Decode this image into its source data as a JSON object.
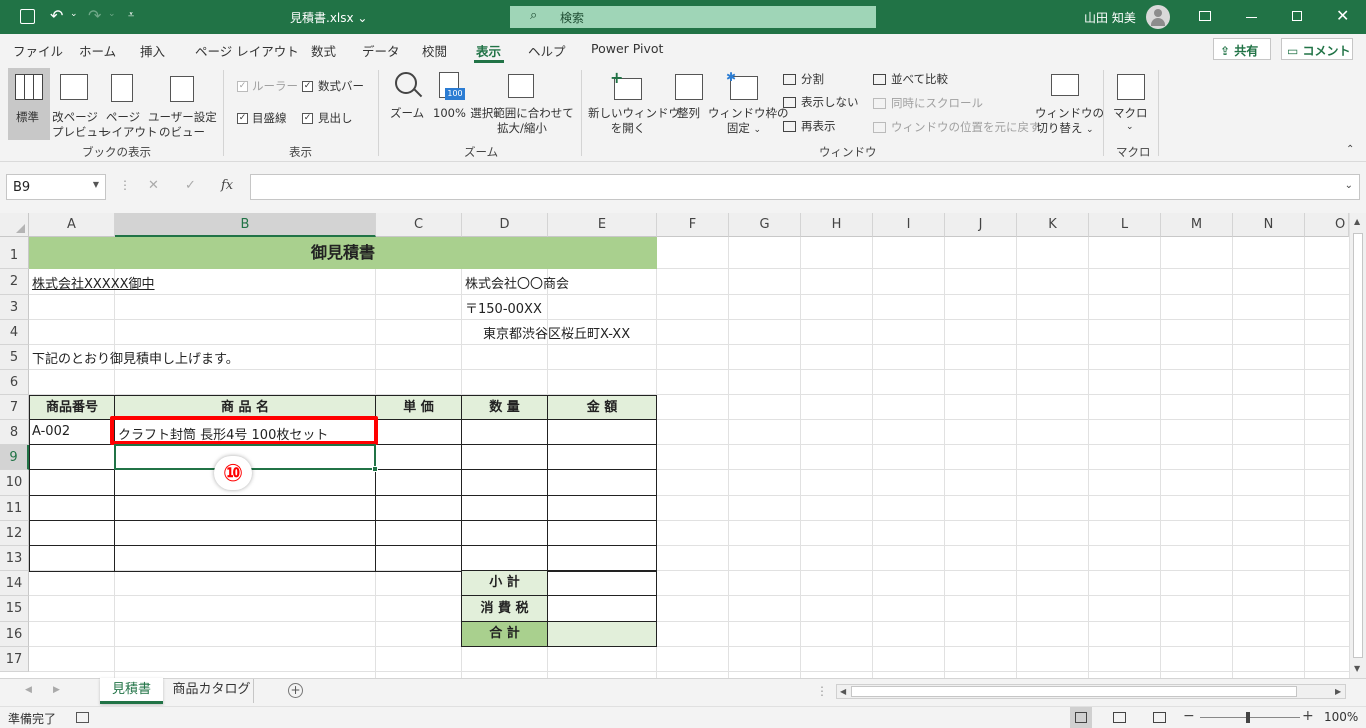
{
  "titlebar": {
    "filename": "見積書.xlsx",
    "search_placeholder": "検索",
    "user_name": "山田 知美"
  },
  "tabs": [
    "ファイル",
    "ホーム",
    "挿入",
    "ページ レイアウト",
    "数式",
    "データ",
    "校閲",
    "表示",
    "ヘルプ",
    "Power Pivot"
  ],
  "active_tab": "表示",
  "share_label": "共有",
  "comment_label": "コメント",
  "ribbon": {
    "workbook_views": {
      "group_label": "ブックの表示",
      "normal": "標準",
      "page_break_1": "改ページ",
      "page_break_2": "プレビュー",
      "page_layout_1": "ページ",
      "page_layout_2": "レイアウト",
      "custom_1": "ユーザー設定",
      "custom_2": "のビュー"
    },
    "show": {
      "group_label": "表示",
      "ruler": "ルーラー",
      "formula_bar": "数式バー",
      "gridlines": "目盛線",
      "headings": "見出し"
    },
    "zoom": {
      "group_label": "ズーム",
      "zoom": "ズーム",
      "hundred": "100%",
      "hundred_icon": "100",
      "selection_1": "選択範囲に合わせて",
      "selection_2": "拡大/縮小"
    },
    "window": {
      "group_label": "ウィンドウ",
      "new_window_1": "新しいウィンドウ",
      "new_window_2": "を開く",
      "arrange": "整列",
      "freeze_1": "ウィンドウ枠の",
      "freeze_2": "固定",
      "split": "分割",
      "hide": "表示しない",
      "unhide": "再表示",
      "side_by_side": "並べて比較",
      "sync_scroll": "同時にスクロール",
      "reset_position": "ウィンドウの位置を元に戻す",
      "switch_1": "ウィンドウの",
      "switch_2": "切り替え"
    },
    "macros": {
      "group_label": "マクロ",
      "macro": "マクロ"
    }
  },
  "formula_bar": {
    "name_box": "B9",
    "fx": "fx",
    "value": ""
  },
  "columns": [
    "A",
    "B",
    "C",
    "D",
    "E",
    "F",
    "G",
    "H",
    "I",
    "J",
    "K",
    "L",
    "M",
    "N",
    "O"
  ],
  "rows": [
    "1",
    "2",
    "3",
    "4",
    "5",
    "6",
    "7",
    "8",
    "9",
    "10",
    "11",
    "12",
    "13",
    "14",
    "15",
    "16",
    "17"
  ],
  "sheet": {
    "title": "御見積書",
    "client": "株式会社XXXXX御中",
    "company": "株式会社〇〇商会",
    "postal": "〒150-00XX",
    "address": "東京都渋谷区桜丘町X-XX",
    "intro": "下記のとおり御見積申し上げます。",
    "headers": [
      "商品番号",
      "商 品 名",
      "単 価",
      "数 量",
      "金 額"
    ],
    "item_code": "A-002",
    "item_name": "クラフト封筒 長形4号 100枚セット",
    "subtotal": "小 計",
    "tax": "消 費 税",
    "total": "合 計"
  },
  "annotation": "⑩",
  "sheet_tabs": [
    "見積書",
    "商品カタログ"
  ],
  "active_sheet": "見積書",
  "status": {
    "ready": "準備完了",
    "zoom": "100%"
  },
  "colors": {
    "excel_green": "#217346",
    "header_fill": "#e2efda",
    "title_fill": "#a9d08e",
    "total_fill": "#a9d08e",
    "highlight": "#ff0000"
  }
}
